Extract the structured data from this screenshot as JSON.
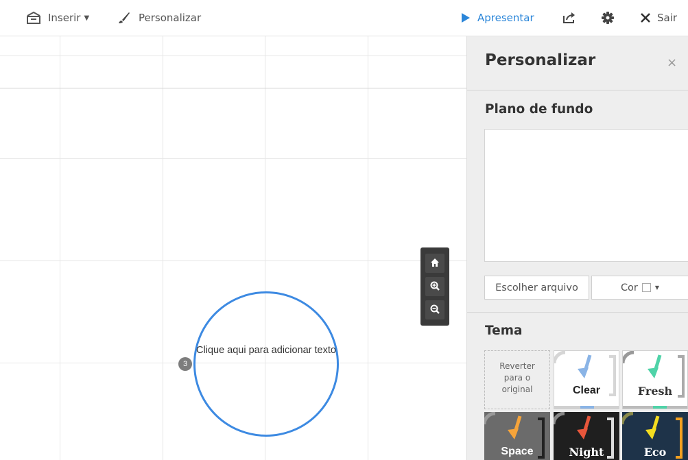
{
  "toolbar": {
    "insert_label": "Inserir",
    "customize_label": "Personalizar",
    "present_label": "Apresentar",
    "exit_label": "Sair"
  },
  "canvas": {
    "circle_text": "Clique aqui para adicionar texto",
    "step_number": "3"
  },
  "panel": {
    "title": "Personalizar",
    "close_label": "×",
    "background_title": "Plano de fundo",
    "choose_file_label": "Escolher arquivo",
    "color_label": "Cor",
    "theme_title": "Tema",
    "revert_label": "Reverter para o original",
    "themes": [
      {
        "name": "Clear",
        "bg": "#ffffff",
        "text": "#222222",
        "arrow": "#8ab4e6"
      },
      {
        "name": "Fresh",
        "bg": "#ffffff",
        "text": "#333333",
        "arrow": "#4fd3a8"
      },
      {
        "name": "Space",
        "bg": "#6b6b6b",
        "text": "#ffffff",
        "arrow": "#f6a43a"
      },
      {
        "name": "Night",
        "bg": "#1f1f1f",
        "text": "#ffffff",
        "arrow": "#e8563b"
      },
      {
        "name": "Eco",
        "bg": "#1e3349",
        "text": "#ffffff",
        "arrow": "#f4dd20"
      }
    ]
  },
  "colors": {
    "accent": "#2b86d9",
    "circle": "#3d8ae2"
  }
}
